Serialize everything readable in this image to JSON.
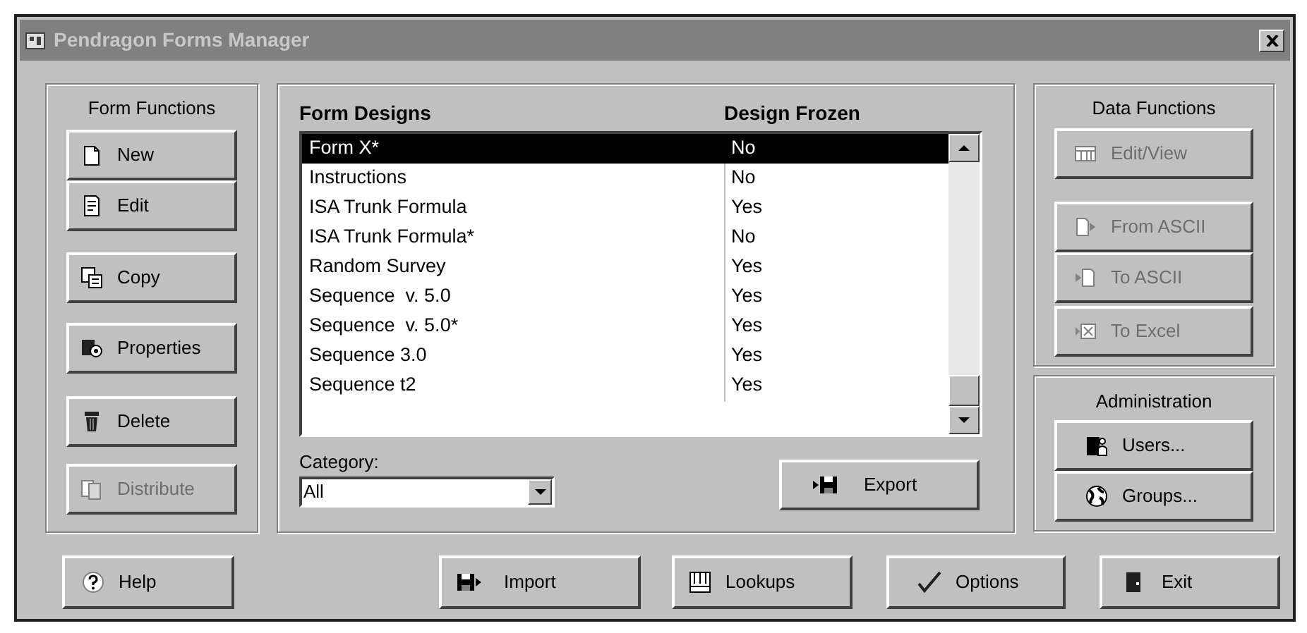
{
  "window": {
    "title": "Pendragon Forms Manager"
  },
  "form_functions": {
    "label": "Form Functions",
    "buttons": [
      {
        "label": "New",
        "disabled": false
      },
      {
        "label": "Edit",
        "disabled": false
      },
      {
        "label": "Copy",
        "disabled": false
      },
      {
        "label": "Properties",
        "disabled": false
      },
      {
        "label": "Delete",
        "disabled": false
      },
      {
        "label": "Distribute",
        "disabled": true
      }
    ]
  },
  "form_list": {
    "columns": [
      "Form Designs",
      "Design Frozen"
    ],
    "rows": [
      {
        "name": "Form X*",
        "frozen": "No",
        "selected": true
      },
      {
        "name": "Instructions",
        "frozen": "No",
        "selected": false
      },
      {
        "name": "ISA Trunk Formula",
        "frozen": "Yes",
        "selected": false
      },
      {
        "name": "ISA Trunk Formula*",
        "frozen": "No",
        "selected": false
      },
      {
        "name": "Random Survey",
        "frozen": "Yes",
        "selected": false
      },
      {
        "name": "Sequence  v. 5.0",
        "frozen": "Yes",
        "selected": false
      },
      {
        "name": "Sequence  v. 5.0*",
        "frozen": "Yes",
        "selected": false
      },
      {
        "name": "Sequence 3.0",
        "frozen": "Yes",
        "selected": false
      },
      {
        "name": "Sequence t2",
        "frozen": "Yes",
        "selected": false
      }
    ]
  },
  "category": {
    "label": "Category:",
    "value": "All"
  },
  "export_button": {
    "label": "Export",
    "disabled": false
  },
  "data_functions": {
    "label": "Data Functions",
    "buttons": [
      {
        "label": "Edit/View",
        "disabled": true
      },
      {
        "label": "From ASCII",
        "disabled": true
      },
      {
        "label": "To ASCII",
        "disabled": true
      },
      {
        "label": "To Excel",
        "disabled": true
      }
    ]
  },
  "administration": {
    "label": "Administration",
    "buttons": [
      {
        "label": "Users...",
        "disabled": false
      },
      {
        "label": "Groups...",
        "disabled": false
      }
    ]
  },
  "bottom_buttons": [
    {
      "label": "Help",
      "disabled": false
    },
    {
      "label": "Import",
      "disabled": false
    },
    {
      "label": "Lookups",
      "disabled": false
    },
    {
      "label": "Options",
      "disabled": false
    },
    {
      "label": "Exit",
      "disabled": false
    }
  ]
}
